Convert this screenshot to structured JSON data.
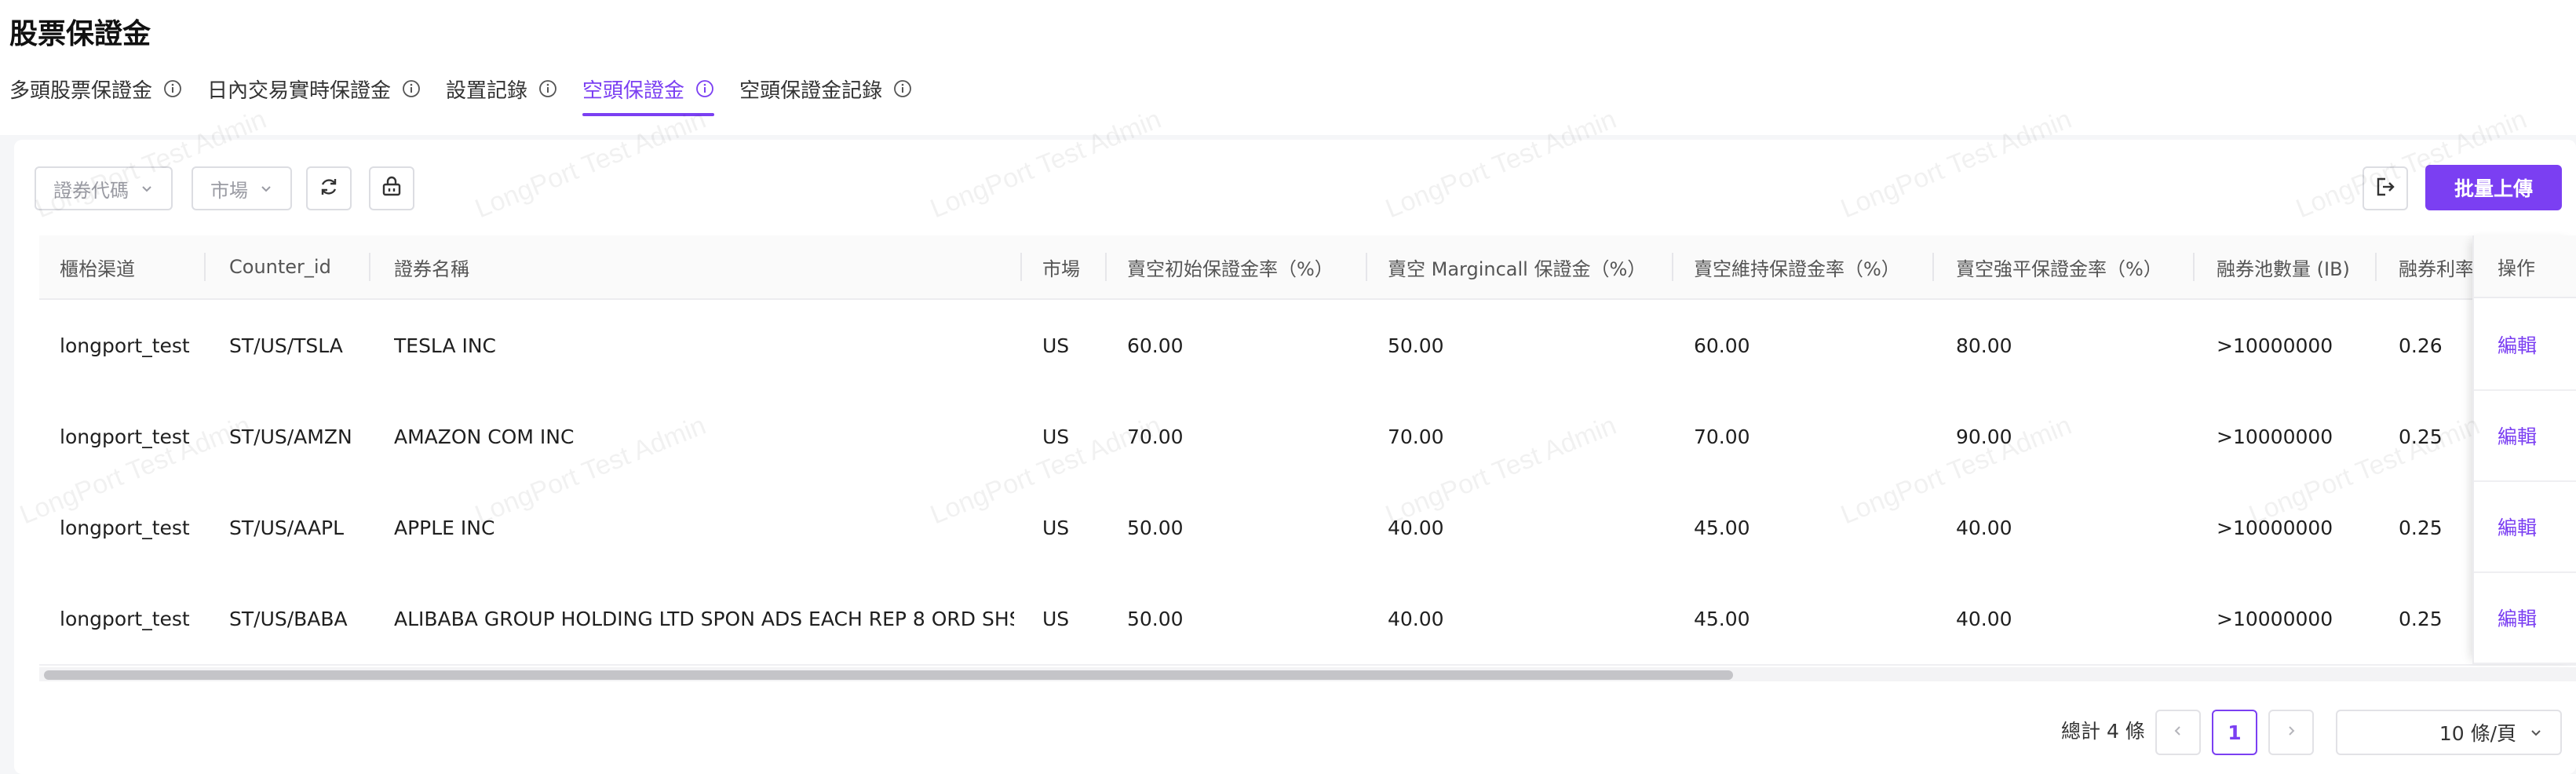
{
  "page": {
    "title": "股票保證金"
  },
  "tabs": [
    {
      "label": "多頭股票保證金",
      "active": false
    },
    {
      "label": "日內交易實時保證金",
      "active": false
    },
    {
      "label": "設置記錄",
      "active": false
    },
    {
      "label": "空頭保證金",
      "active": true
    },
    {
      "label": "空頭保證金記錄",
      "active": false
    }
  ],
  "filters": {
    "security_code": {
      "placeholder": "證券代碼",
      "icon": "chevron-down-icon"
    },
    "market": {
      "placeholder": "市場",
      "icon": "chevron-down-icon"
    }
  },
  "toolbar": {
    "refresh_icon": "refresh-icon",
    "basket_icon": "basket-icon",
    "export_icon": "export-icon",
    "bulk_upload_label": "批量上傳"
  },
  "table": {
    "columns": [
      "櫃枱渠道",
      "Counter_id",
      "證券名稱",
      "市場",
      "賣空初始保證金率（%）",
      "賣空 Margincall 保證金（%）",
      "賣空維持保證金率（%）",
      "賣空強平保證金率（%）",
      "融券池數量 (IB)",
      "融券利率",
      "操作"
    ],
    "rows": [
      {
        "channel": "longport_test",
        "counter_id": "ST/US/TSLA",
        "name": "TESLA INC",
        "market": "US",
        "initial": "60.00",
        "margincall": "50.00",
        "maintenance": "60.00",
        "liquidation": "80.00",
        "pool": ">10000000",
        "rate": "0.26",
        "action": "編輯"
      },
      {
        "channel": "longport_test",
        "counter_id": "ST/US/AMZN",
        "name": "AMAZON COM INC",
        "market": "US",
        "initial": "70.00",
        "margincall": "70.00",
        "maintenance": "70.00",
        "liquidation": "90.00",
        "pool": ">10000000",
        "rate": "0.25",
        "action": "編輯"
      },
      {
        "channel": "longport_test",
        "counter_id": "ST/US/AAPL",
        "name": "APPLE INC",
        "market": "US",
        "initial": "50.00",
        "margincall": "40.00",
        "maintenance": "45.00",
        "liquidation": "40.00",
        "pool": ">10000000",
        "rate": "0.25",
        "action": "編輯"
      },
      {
        "channel": "longport_test",
        "counter_id": "ST/US/BABA",
        "name": "ALIBABA GROUP HOLDING LTD SPON ADS EACH REP 8 ORD SHS",
        "market": "US",
        "initial": "50.00",
        "margincall": "40.00",
        "maintenance": "45.00",
        "liquidation": "40.00",
        "pool": ">10000000",
        "rate": "0.25",
        "action": "編輯"
      }
    ]
  },
  "pagination": {
    "total_text": "總計 4 條",
    "current_page": "1",
    "page_size_label": "10 條/頁"
  },
  "watermark": "LongPort Test Admin",
  "colors": {
    "accent": "#7b3ff2",
    "background": "#f5f6f8"
  }
}
